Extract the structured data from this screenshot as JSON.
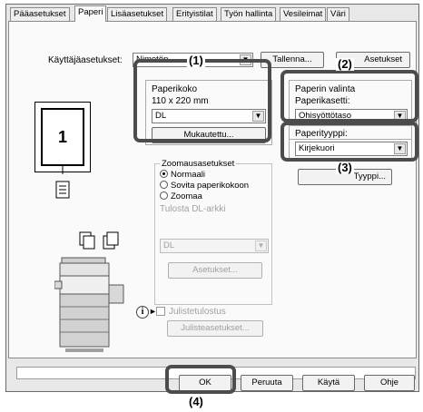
{
  "tabs": [
    "Pääasetukset",
    "Paperi",
    "Lisäasetukset",
    "Erityistilat",
    "Työn hallinta",
    "Vesileimat",
    "Väri"
  ],
  "active_tab": "Paperi",
  "user_settings": {
    "label": "Käyttäjäasetukset:",
    "value": "Nimetön",
    "save_button": "Tallenna...",
    "settings_button": "Asetukset"
  },
  "preview": {
    "page_number": "1"
  },
  "paper_size": {
    "title": "Paperikoko",
    "dimensions": "110 x 220 mm",
    "value": "DL",
    "custom_button": "Mukautettu..."
  },
  "paper_selection": {
    "title": "Paperin valinta",
    "tray_label": "Paperikasetti:",
    "tray_value": "Ohisyöttötaso",
    "type_label": "Paperityyppi:",
    "type_value": "Kirjekuori",
    "type_button": "Tyyppi..."
  },
  "zoom": {
    "title": "Zoomausasetukset",
    "options": [
      "Normaali",
      "Sovita paperikokoon",
      "Zoomaa"
    ],
    "print_dl_label": "Tulosta DL-arkki",
    "dl_value": "DL",
    "settings_button": "Asetukset..."
  },
  "poster": {
    "checkbox_label": "Julistetulostus",
    "settings_button": "Julisteasetukset..."
  },
  "footer": {
    "ok": "OK",
    "cancel": "Peruuta",
    "apply": "Käytä",
    "help": "Ohje"
  },
  "callouts": [
    "(1)",
    "(2)",
    "(3)",
    "(4)"
  ]
}
